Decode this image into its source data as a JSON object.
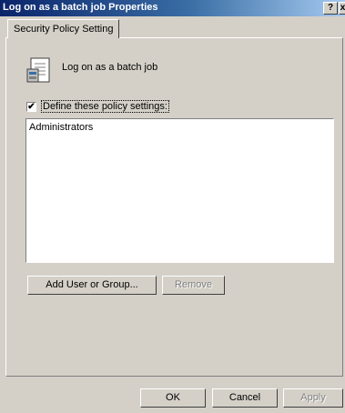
{
  "window": {
    "title": "Log on as a batch job Properties",
    "help_label": "?",
    "close_label": "x"
  },
  "tabs": [
    {
      "label": "Security Policy Setting",
      "selected": true
    }
  ],
  "policy": {
    "icon": "policy-document-icon",
    "name": "Log on as a batch job"
  },
  "define_checkbox": {
    "label": "Define these policy settings:",
    "checked": true,
    "mark": "✔"
  },
  "accounts_list": {
    "items": [
      "Administrators"
    ]
  },
  "buttons": {
    "add": "Add User or Group...",
    "remove": "Remove",
    "ok": "OK",
    "cancel": "Cancel",
    "apply": "Apply"
  }
}
